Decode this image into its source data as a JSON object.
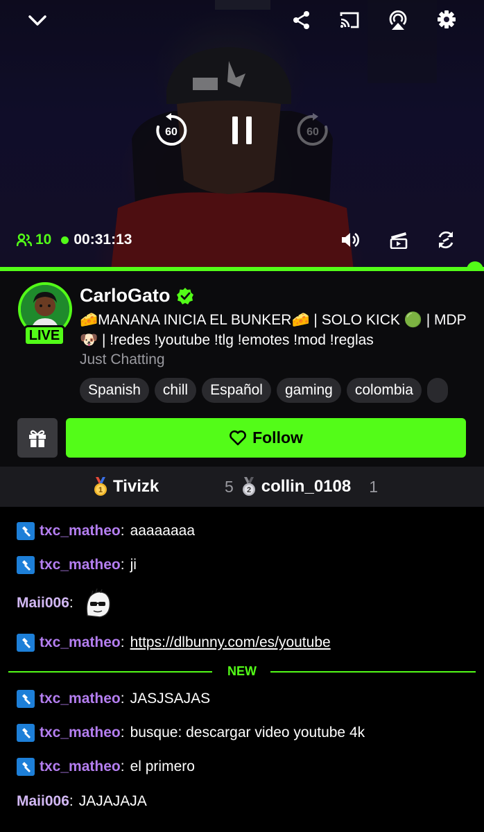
{
  "player": {
    "viewer_count": "10",
    "uptime": "00:31:13",
    "rewind_seconds": "60",
    "forward_seconds": "60",
    "progress_fraction": 1.0,
    "accent_color": "#53fc18"
  },
  "channel": {
    "name": "CarloGato",
    "live_label": "LIVE",
    "title": "🧀MANANA INICIA EL BUNKER🧀 | SOLO KICK 🟢 | MDP 🐶 | !redes !youtube !tlg !emotes !mod !reglas",
    "category": "Just Chatting",
    "tags": [
      "Spanish",
      "chill",
      "Español",
      "gaming",
      "colombia"
    ],
    "follow_label": "Follow"
  },
  "leaderboard": [
    {
      "rank": "1",
      "name": "Tivizk",
      "count": "5"
    },
    {
      "rank": "2",
      "name": "collin_0108",
      "count": "1"
    }
  ],
  "chat": {
    "new_label": "NEW",
    "messages": [
      {
        "user": "txc_matheo",
        "text": "aaaaaaaa"
      },
      {
        "user": "txc_matheo",
        "text": "ji"
      },
      {
        "user": "Maii006",
        "text": ""
      },
      {
        "user": "txc_matheo",
        "text": "https://dlbunny.com/es/youtube"
      },
      {
        "user": "txc_matheo",
        "text": "JASJSAJAS"
      },
      {
        "user": "txc_matheo",
        "text": "busque: descargar video youtube 4k"
      },
      {
        "user": "txc_matheo",
        "text": "el primero"
      },
      {
        "user": "Maii006",
        "text": "JAJAJAJA"
      }
    ]
  },
  "icons": {
    "minimize": "chevron-down-icon",
    "share": "share-icon",
    "cast": "cast-icon",
    "airplay": "airplay-icon",
    "settings": "gear-icon",
    "mod_badge": "hammer-icon"
  }
}
